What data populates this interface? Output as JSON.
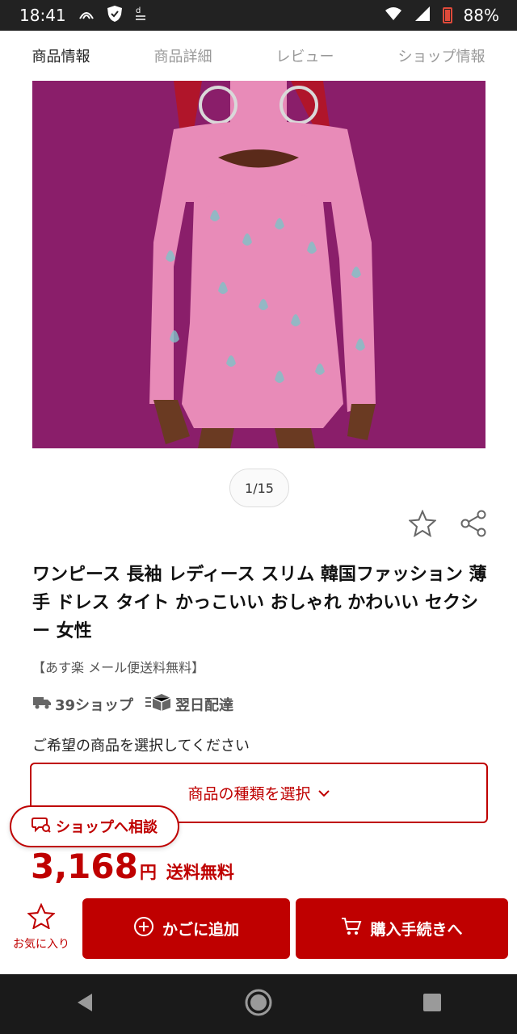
{
  "status_bar": {
    "time": "18:41",
    "battery": "88%",
    "icons": [
      "nfc-icon",
      "shield-icon",
      "docomo-icon",
      "wifi-icon",
      "signal-icon",
      "battery-icon"
    ]
  },
  "tabs": [
    {
      "label": "商品情報",
      "active": true
    },
    {
      "label": "商品詳細",
      "active": false
    },
    {
      "label": "レビュー",
      "active": false
    },
    {
      "label": "ショップ情報",
      "active": false
    }
  ],
  "gallery": {
    "pager": "1/15",
    "image_description_icon": "product-photo"
  },
  "product": {
    "title": "ワンピース 長袖 レディース スリム 韓国ファッション 薄手 ドレス タイト かっこいい おしゃれ かわいい セクシー 女性",
    "promo": "【あす楽 メール便送料無料】",
    "badge_shop": "39ショップ",
    "badge_delivery": "翌日配達",
    "select_prompt": "ご希望の商品を選択してください",
    "select_button": "商品の種類を選択",
    "price_number": "3,168",
    "price_unit": "円",
    "shipping": "送料無料"
  },
  "consult_button": "ショップへ相談",
  "bottom_actions": {
    "favorite": "お気に入り",
    "add_to_cart": "かごに追加",
    "checkout": "購入手続きへ"
  },
  "colors": {
    "accent": "#bf0000",
    "photo_bg": "#8a1e6a",
    "dress_pink": "#e88bb8"
  }
}
